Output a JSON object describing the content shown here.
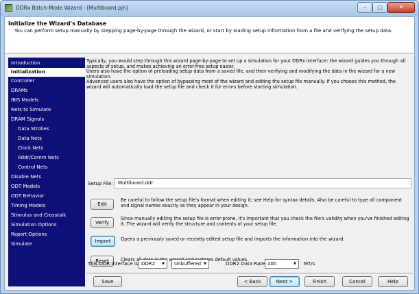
{
  "window": {
    "title": "DDRx Batch-Mode Wizard - [Multiboard.pjh]"
  },
  "header": {
    "title": "Initialize the Wizard's Database",
    "description": "You can perform setup manually by stepping page-by-page through the wizard, or start by loading setup information from a file and verifying the setup data."
  },
  "sidebar": {
    "items": [
      {
        "label": "Introduction"
      },
      {
        "label": "Initialization"
      },
      {
        "label": "Controller"
      },
      {
        "label": "DRAMs"
      },
      {
        "label": "IBIS Models"
      },
      {
        "label": "Nets to Simulate"
      },
      {
        "label": "DRAM Signals"
      },
      {
        "label": "Data Strobes"
      },
      {
        "label": "Data Nets"
      },
      {
        "label": "Clock Nets"
      },
      {
        "label": "Addr/Comm Nets"
      },
      {
        "label": "Control Nets"
      },
      {
        "label": "Disable Nets"
      },
      {
        "label": "ODT Models"
      },
      {
        "label": "ODT Behavior"
      },
      {
        "label": "Timing Models"
      },
      {
        "label": "Stimulus and Crosstalk"
      },
      {
        "label": "Simulation Options"
      },
      {
        "label": "Report Options"
      },
      {
        "label": "Simulate"
      }
    ]
  },
  "main": {
    "intro": [
      "Typically, you would step through this wizard page-by-page to set up a simulation for your DDRx interface: the wizard guides you through all aspects of setup, and makes achieving an error-free setup easier.",
      "Users also have the option of preloading setup data from a saved file, and then verifying and modifying the data in the wizard for a new simulation.",
      "Advanced users also have the option of bypassing most of the wizard and editing the setup file manually. If you choose this method, the wizard will automatically load the setup file and check it for errors before starting simulation."
    ],
    "setup_file_label": "Setup File:",
    "setup_file_value": "Multiboard.ddr",
    "actions": [
      {
        "label": "Edit",
        "desc": "Be careful to follow the setup file's format when editing it; see Help for syntax details. Also be careful to type all component and signal names exactly as they appear in your design."
      },
      {
        "label": "Verify",
        "desc": "Since manually editing the setup file is error-prone, it's important that you check the file's validity when you've finished editing it. The wizard will verify the structure and contents of your setup file."
      },
      {
        "label": "Import",
        "desc": "Opens a previously saved or recently edited setup file and imports the information into the wizard."
      },
      {
        "label": "Reset",
        "desc": "Clears all data in the wizard and restores default values."
      }
    ],
    "interface_label": "This DDR interface is:",
    "interface_type": "DDR2",
    "buffering": "Unbuffered",
    "data_rate_label": "DDR2 Data Rate:",
    "data_rate": "400",
    "data_rate_unit": "MT/s"
  },
  "footer": {
    "save": "Save",
    "back": "< Back",
    "next": "Next >",
    "finish": "Finish",
    "cancel": "Cancel",
    "help": "Help"
  }
}
